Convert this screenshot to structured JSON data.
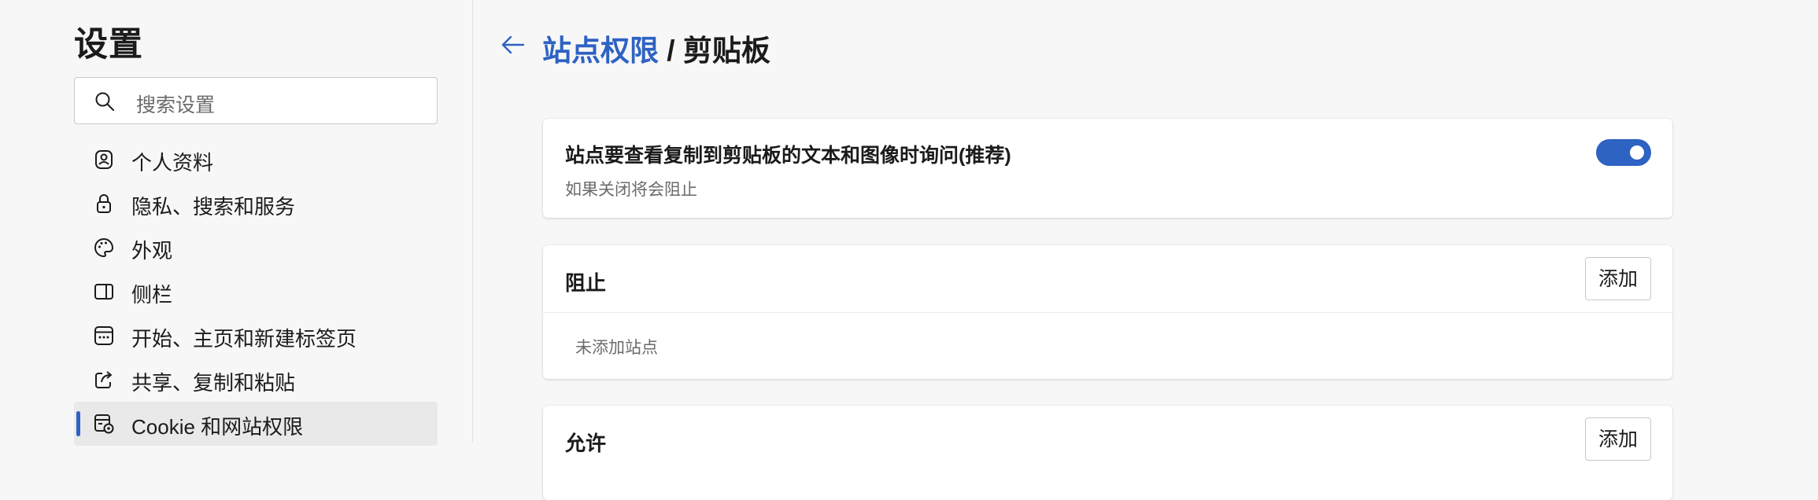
{
  "sidebar": {
    "title": "设置",
    "search": {
      "placeholder": "搜索设置",
      "icon": "search-icon"
    },
    "items": [
      {
        "label": "个人资料",
        "icon": "profile-icon",
        "selected": false
      },
      {
        "label": "隐私、搜索和服务",
        "icon": "lock-icon",
        "selected": false
      },
      {
        "label": "外观",
        "icon": "palette-icon",
        "selected": false
      },
      {
        "label": "侧栏",
        "icon": "sidebar-icon",
        "selected": false
      },
      {
        "label": "开始、主页和新建标签页",
        "icon": "start-page-icon",
        "selected": false
      },
      {
        "label": "共享、复制和粘贴",
        "icon": "share-icon",
        "selected": false
      },
      {
        "label": "Cookie 和网站权限",
        "icon": "site-permissions-icon",
        "selected": true
      }
    ]
  },
  "header": {
    "back_icon": "back-arrow-icon",
    "breadcrumb_link": "站点权限",
    "separator": " / ",
    "current": "剪贴板"
  },
  "ask_card": {
    "title": "站点要查看复制到剪贴板的文本和图像时询问(推荐)",
    "subtitle": "如果关闭将会阻止",
    "toggle_on": true
  },
  "block_card": {
    "title": "阻止",
    "add_label": "添加",
    "empty_text": "未添加站点"
  },
  "allow_card": {
    "title": "允许",
    "add_label": "添加"
  },
  "colors": {
    "accent": "#2e62c3",
    "background": "#f7f7f7",
    "card": "#ffffff",
    "selected_item": "#e9e9e9"
  }
}
